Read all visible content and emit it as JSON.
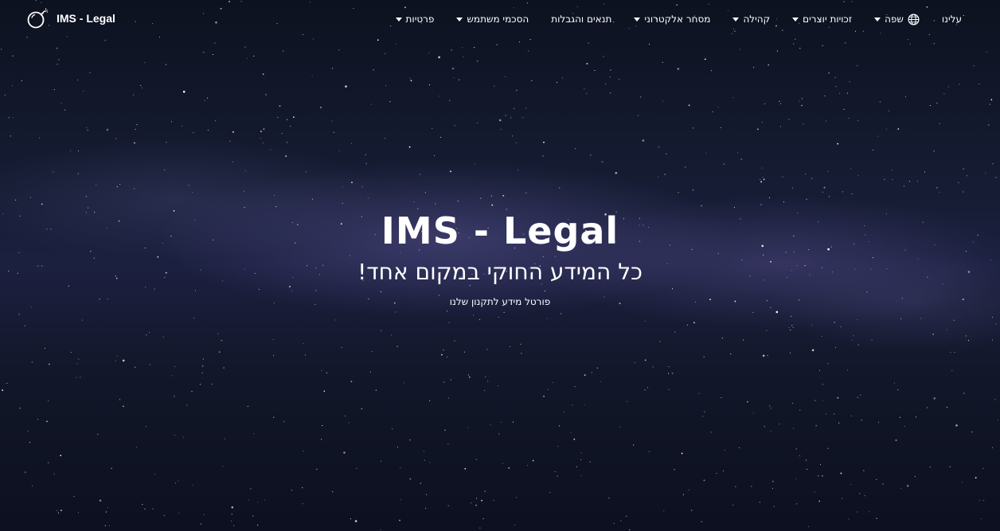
{
  "brand": {
    "title": "IMS - Legal",
    "logo_icon": "bomb-icon"
  },
  "nav": {
    "items": [
      {
        "label": "עלינו",
        "dropdown": false
      },
      {
        "label": "שפה",
        "dropdown": true,
        "icon": "globe-icon"
      },
      {
        "label": "זכויות יוצרים",
        "dropdown": true
      },
      {
        "label": "קהילה",
        "dropdown": true
      },
      {
        "label": "מסחר אלקטרוני",
        "dropdown": true
      },
      {
        "label": "תנאים והגבלות",
        "dropdown": false
      },
      {
        "label": "הסכמי משתמש",
        "dropdown": true
      },
      {
        "label": "פרטיות",
        "dropdown": true
      }
    ]
  },
  "hero": {
    "title": "IMS - Legal",
    "subtitle": "כל המידע החוקי במקום אחד!",
    "caption": "פורטל מידע לתקנון שלנו"
  },
  "colors": {
    "text": "#ffffff",
    "background": "#161c33"
  }
}
